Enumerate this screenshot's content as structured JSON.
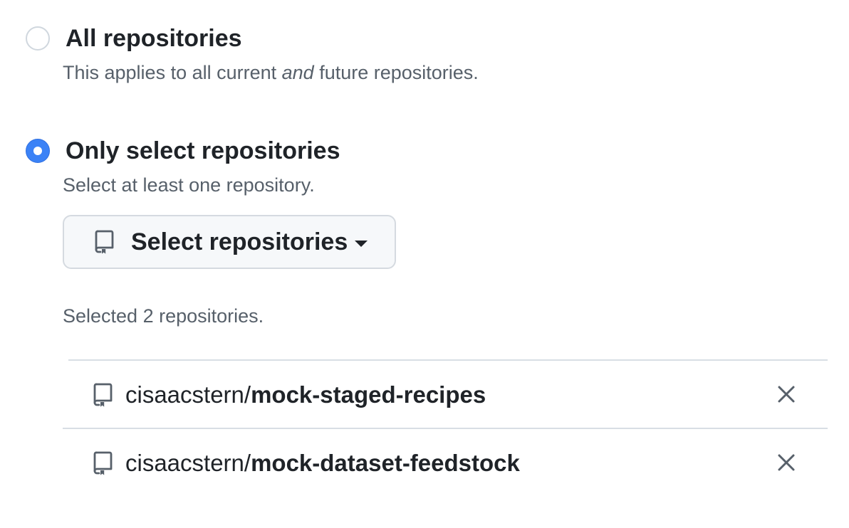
{
  "options": {
    "all": {
      "label": "All repositories",
      "desc_before": "This applies to all current ",
      "desc_em": "and",
      "desc_after": " future repositories.",
      "selected": false
    },
    "select": {
      "label": "Only select repositories",
      "desc": "Select at least one repository.",
      "selected": true
    }
  },
  "select_button": {
    "label": "Select repositories",
    "icon": "repo-icon",
    "caret_icon": "caret-down-icon"
  },
  "selected_summary": "Selected 2 repositories.",
  "repositories": [
    {
      "owner": "cisaacstern/",
      "name": "mock-staged-recipes",
      "icon": "repo-icon",
      "remove_icon": "x-icon"
    },
    {
      "owner": "cisaacstern/",
      "name": "mock-dataset-feedstock",
      "icon": "repo-icon",
      "remove_icon": "x-icon"
    }
  ],
  "colors": {
    "radio_selected": "#3b82f6",
    "text_primary": "#1f2328",
    "text_muted": "#57606a",
    "border": "#d0d7de",
    "button_bg": "#f6f8fa"
  }
}
